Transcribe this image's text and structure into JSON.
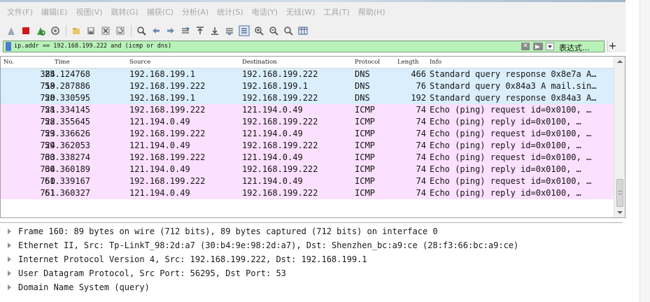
{
  "menu": [
    "文件(F)",
    "编辑(E)",
    "视图(V)",
    "跳转(G)",
    "捕获(C)",
    "分析(A)",
    "统计(S)",
    "电话(Y)",
    "无线(W)",
    "工具(T)",
    "帮助(H)"
  ],
  "filter": {
    "value": "ip.addr == 192.168.199.222 and (icmp or dns)",
    "expression_label": "表达式…",
    "add_label": "+"
  },
  "columns": [
    "No.",
    "Time",
    "Source",
    "Destination",
    "Protocol",
    "Length",
    "Info"
  ],
  "packets": [
    {
      "no": "384",
      "time": "25.124768",
      "src": "192.168.199.1",
      "dst": "192.168.199.222",
      "proto": "DNS",
      "len": "466",
      "info": "Standard query response 0x8e7a A…"
    },
    {
      "no": "719",
      "time": "58.287886",
      "src": "192.168.199.222",
      "dst": "192.168.199.1",
      "proto": "DNS",
      "len": "76",
      "info": "Standard query 0x84a3 A mail.sin…"
    },
    {
      "no": "720",
      "time": "58.330595",
      "src": "192.168.199.1",
      "dst": "192.168.199.222",
      "proto": "DNS",
      "len": "192",
      "info": "Standard query response 0x84a3 A…"
    },
    {
      "no": "721",
      "time": "58.334145",
      "src": "192.168.199.222",
      "dst": "121.194.0.49",
      "proto": "ICMP",
      "len": "74",
      "info": "Echo (ping) request  id=0x0100, …"
    },
    {
      "no": "722",
      "time": "58.355645",
      "src": "121.194.0.49",
      "dst": "192.168.199.222",
      "proto": "ICMP",
      "len": "74",
      "info": "Echo (ping) reply    id=0x0100, …"
    },
    {
      "no": "723",
      "time": "59.336626",
      "src": "192.168.199.222",
      "dst": "121.194.0.49",
      "proto": "ICMP",
      "len": "74",
      "info": "Echo (ping) request  id=0x0100, …"
    },
    {
      "no": "724",
      "time": "59.362053",
      "src": "121.194.0.49",
      "dst": "192.168.199.222",
      "proto": "ICMP",
      "len": "74",
      "info": "Echo (ping) reply    id=0x0100, …"
    },
    {
      "no": "733",
      "time": "60.338274",
      "src": "192.168.199.222",
      "dst": "121.194.0.49",
      "proto": "ICMP",
      "len": "74",
      "info": "Echo (ping) request  id=0x0100, …"
    },
    {
      "no": "734",
      "time": "60.360189",
      "src": "121.194.0.49",
      "dst": "192.168.199.222",
      "proto": "ICMP",
      "len": "74",
      "info": "Echo (ping) reply    id=0x0100, …"
    },
    {
      "no": "750",
      "time": "61.339167",
      "src": "192.168.199.222",
      "dst": "121.194.0.49",
      "proto": "ICMP",
      "len": "74",
      "info": "Echo (ping) request  id=0x0100, …"
    },
    {
      "no": "751",
      "time": "61.360327",
      "src": "121.194.0.49",
      "dst": "192.168.199.222",
      "proto": "ICMP",
      "len": "74",
      "info": "Echo (ping) reply    id=0x0100, …"
    }
  ],
  "details": [
    "Frame 160: 89 bytes on wire (712 bits), 89 bytes captured (712 bits) on interface 0",
    "Ethernet II, Src: Tp-LinkT_98:2d:a7 (30:b4:9e:98:2d:a7), Dst: Shenzhen_bc:a9:ce (28:f3:66:bc:a9:ce)",
    "Internet Protocol Version 4, Src: 192.168.199.222, Dst: 192.168.199.1",
    "User Datagram Protocol, Src Port: 56295, Dst Port: 53",
    "Domain Name System (query)"
  ],
  "colors": {
    "dns_row": "#daeefc",
    "icmp_row": "#fce0ff",
    "filter_valid": "#b9f2b9"
  },
  "toolbar_icons": [
    "shark-fin-start-icon",
    "stop-capture-icon",
    "restart-capture-icon",
    "capture-options-icon",
    "open-file-icon",
    "save-file-icon",
    "close-file-icon",
    "reload-file-icon",
    "find-packet-icon",
    "go-back-icon",
    "go-forward-icon",
    "go-to-packet-icon",
    "go-first-icon",
    "go-last-icon",
    "auto-scroll-icon",
    "colorize-icon",
    "zoom-in-icon",
    "zoom-out-icon",
    "zoom-reset-icon",
    "resize-columns-icon"
  ]
}
